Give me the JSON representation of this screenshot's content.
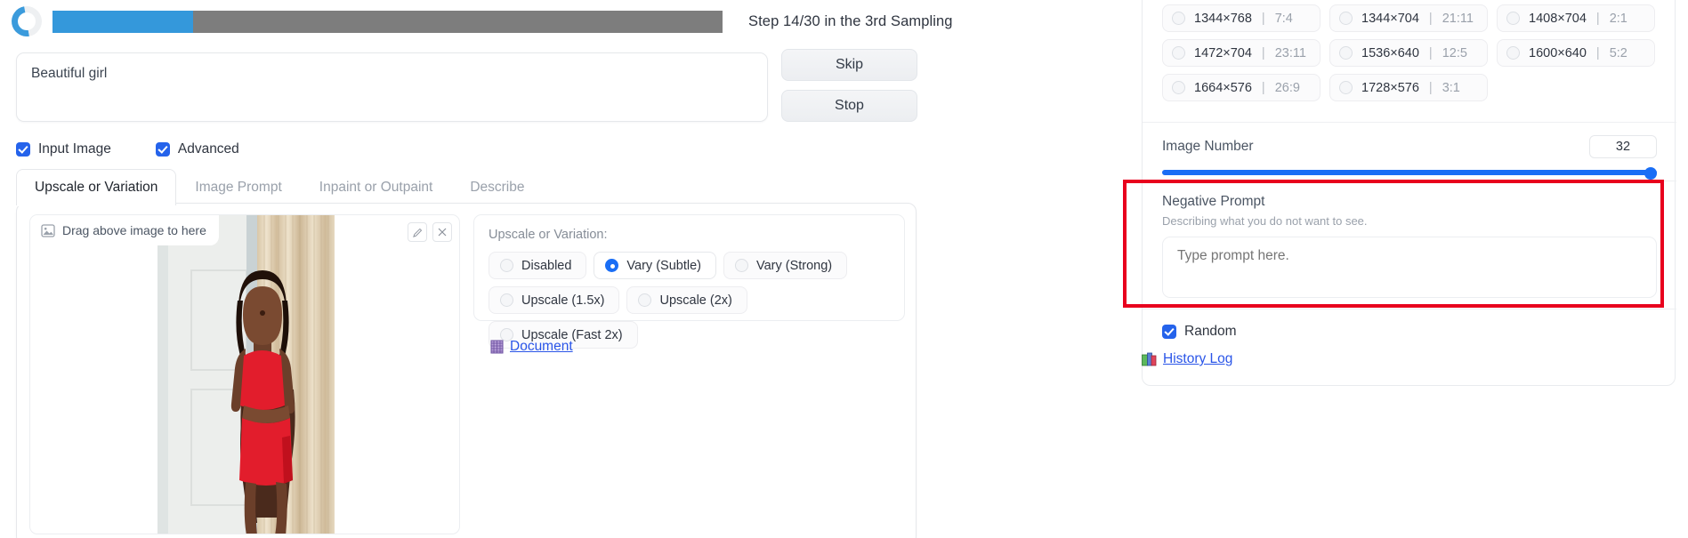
{
  "progress": {
    "status_text": "Step 14/30 in the 3rd Sampling",
    "percent": 21,
    "fill_color": "#3498db",
    "track_color": "#7d7d7d",
    "spinner_icon": "loading-spinner-icon"
  },
  "prompt": {
    "value": "Beautiful girl",
    "placeholder": "Type prompt here."
  },
  "actions": {
    "skip_label": "Skip",
    "stop_label": "Stop"
  },
  "toggles": [
    {
      "label": "Input Image",
      "checked": true
    },
    {
      "label": "Advanced",
      "checked": true
    }
  ],
  "tabs": [
    {
      "label": "Upscale or Variation",
      "active": true
    },
    {
      "label": "Image Prompt",
      "active": false
    },
    {
      "label": "Inpaint or Outpaint",
      "active": false
    },
    {
      "label": "Describe",
      "active": false
    }
  ],
  "drop_zone": {
    "badge_label": "Drag above image to here",
    "badge_icon": "image-placeholder-icon",
    "edit_icon": "pencil-icon",
    "close_icon": "close-x-icon"
  },
  "upscale": {
    "title": "Upscale or Variation:",
    "options": [
      {
        "label": "Disabled",
        "selected": false
      },
      {
        "label": "Vary (Subtle)",
        "selected": true
      },
      {
        "label": "Vary (Strong)",
        "selected": false
      },
      {
        "label": "Upscale (1.5x)",
        "selected": false
      },
      {
        "label": "Upscale (2x)",
        "selected": false
      },
      {
        "label": "Upscale (Fast 2x)",
        "selected": false
      }
    ]
  },
  "document_link": {
    "label": "Document",
    "icon": "book-icon"
  },
  "aspect_ratios": [
    {
      "dim": "1344×768",
      "ratio": "7:4",
      "selected": false
    },
    {
      "dim": "1344×704",
      "ratio": "21:11",
      "selected": false
    },
    {
      "dim": "1408×704",
      "ratio": "2:1",
      "selected": false
    },
    {
      "dim": "1472×704",
      "ratio": "23:11",
      "selected": false
    },
    {
      "dim": "1536×640",
      "ratio": "12:5",
      "selected": false
    },
    {
      "dim": "1600×640",
      "ratio": "5:2",
      "selected": false
    },
    {
      "dim": "1664×576",
      "ratio": "26:9",
      "selected": false
    },
    {
      "dim": "1728×576",
      "ratio": "3:1",
      "selected": false
    }
  ],
  "image_number": {
    "label": "Image Number",
    "value": "32",
    "percent": 100,
    "accent": "#1a6ef5"
  },
  "negative_prompt": {
    "title": "Negative Prompt",
    "subtitle": "Describing what you do not want to see.",
    "placeholder": "Type prompt here.",
    "value": "",
    "highlight_color": "#e8001d"
  },
  "random": {
    "label": "Random",
    "checked": true
  },
  "history_link": {
    "label": "History Log",
    "icon": "books-icon"
  }
}
